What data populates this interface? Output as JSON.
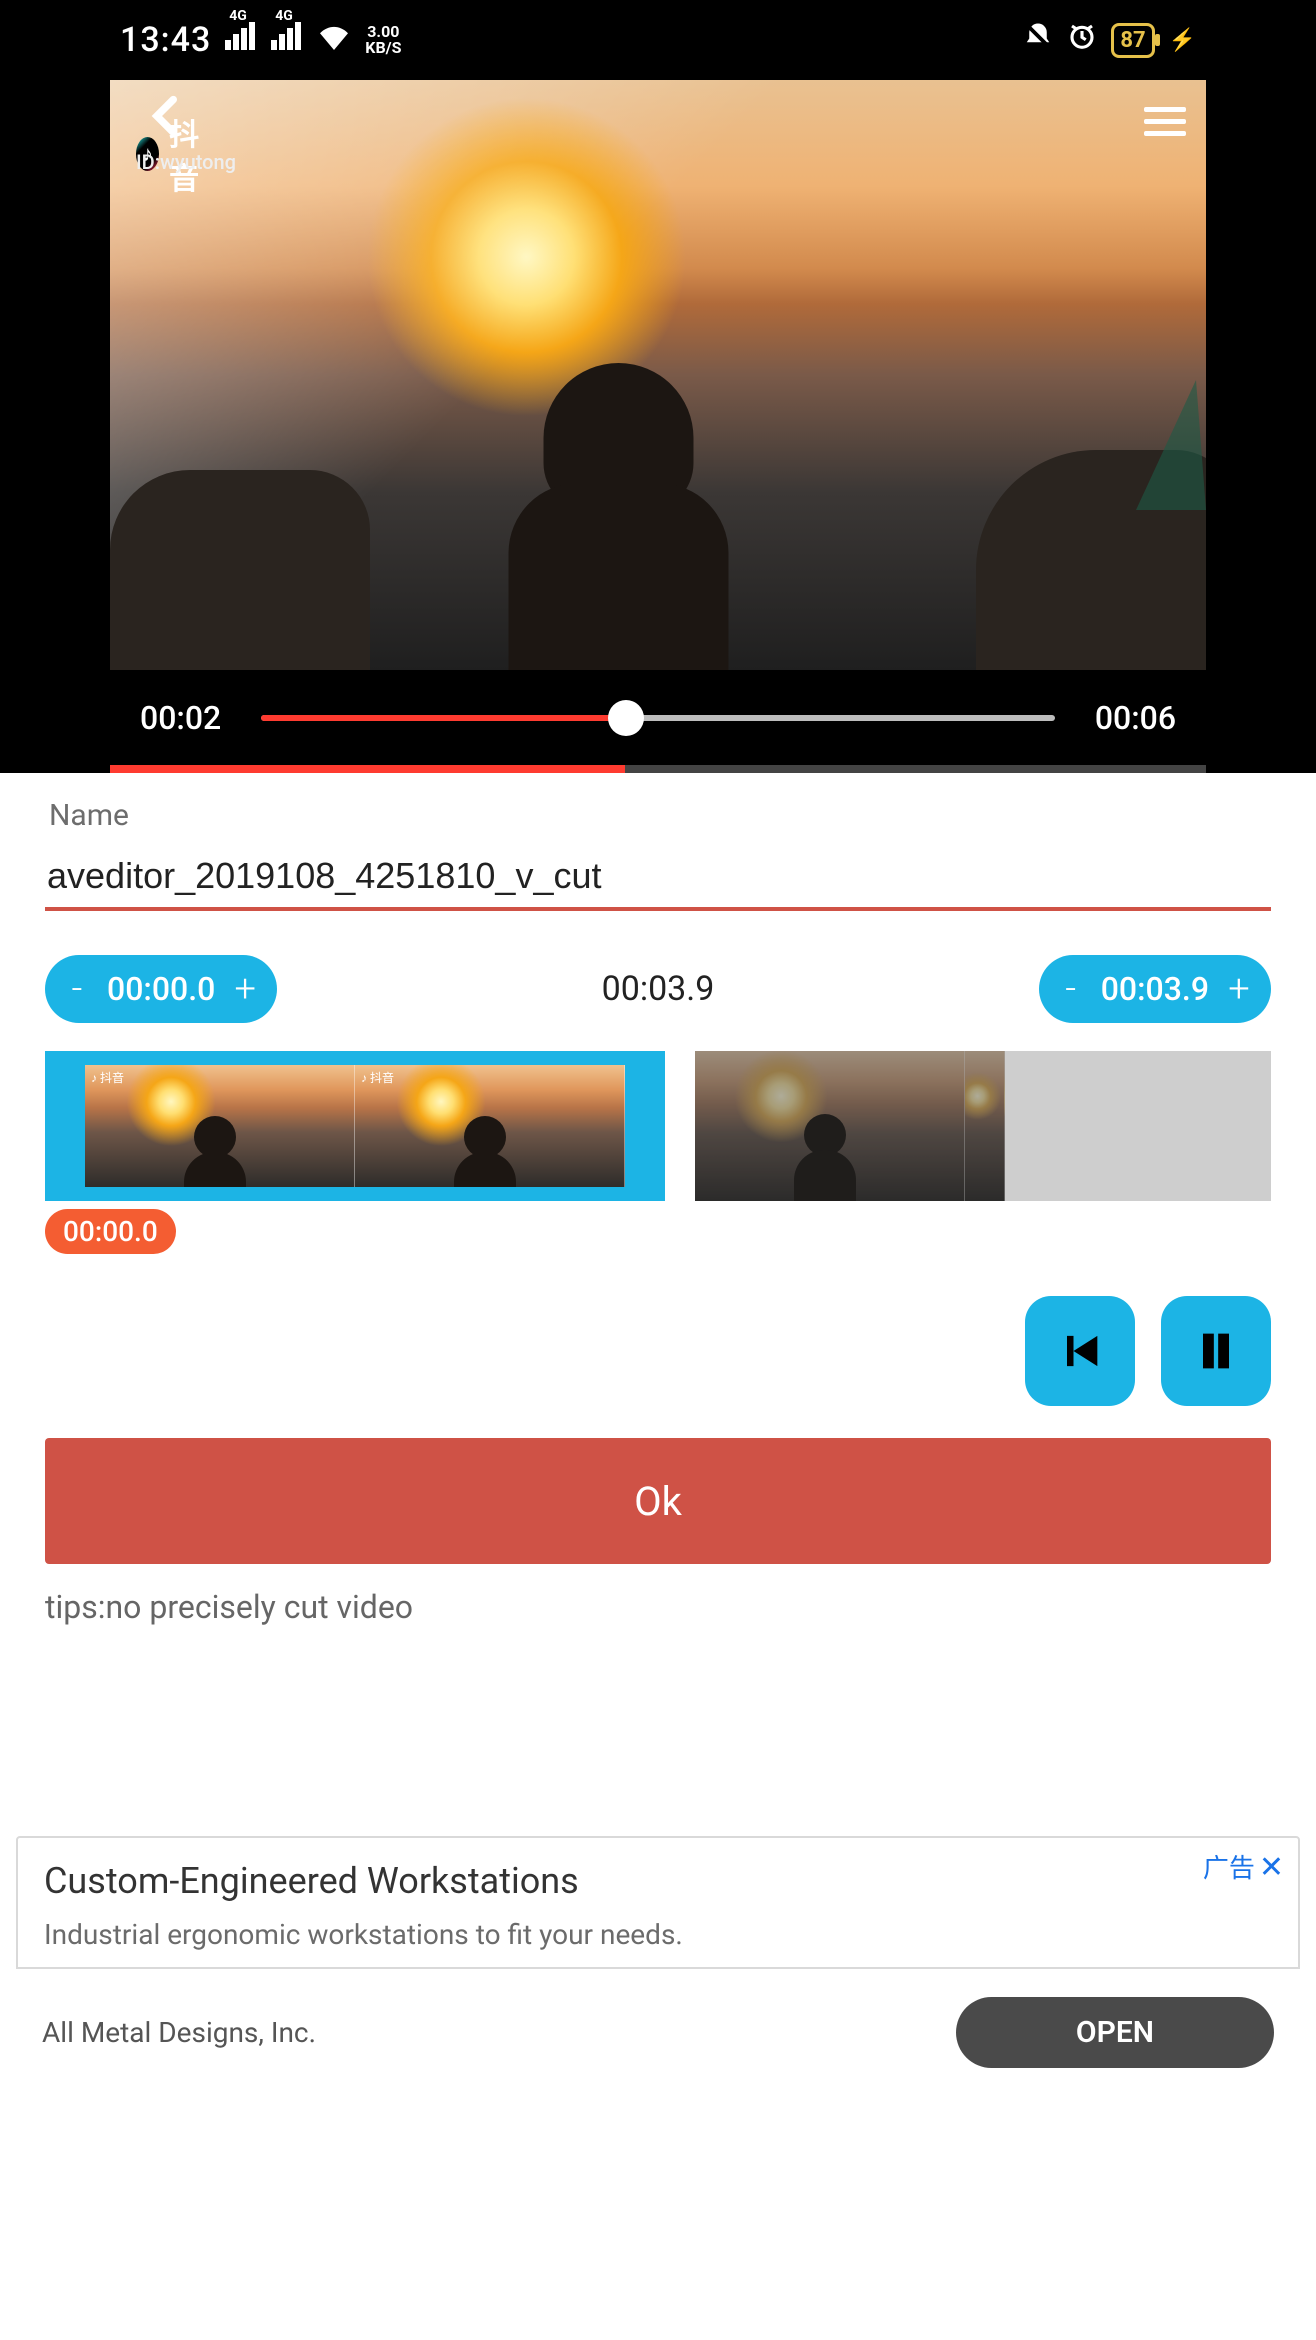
{
  "status": {
    "time": "13:43",
    "signal_label": "4G",
    "speed_value": "3.00",
    "speed_unit": "KB/S",
    "battery": "87"
  },
  "player": {
    "watermark_app": "抖音",
    "watermark_id": "ID:wyutong",
    "current_time": "00:02",
    "total_time": "00:06"
  },
  "form": {
    "name_label": "Name",
    "name_value": "aveditor_2019108_4251810_v_cut"
  },
  "cut": {
    "start": "00:00.0",
    "duration": "00:03.9",
    "end": "00:03.9",
    "minus": "-",
    "plus": "+",
    "position_badge": "00:00.0"
  },
  "actions": {
    "ok": "Ok",
    "tips": "tips:no precisely cut video"
  },
  "ad": {
    "badge": "广告",
    "close": "✕",
    "title": "Custom-Engineered Workstations",
    "subtitle": "Industrial ergonomic workstations to fit your needs.",
    "company": "All Metal Designs, Inc.",
    "open": "OPEN"
  }
}
